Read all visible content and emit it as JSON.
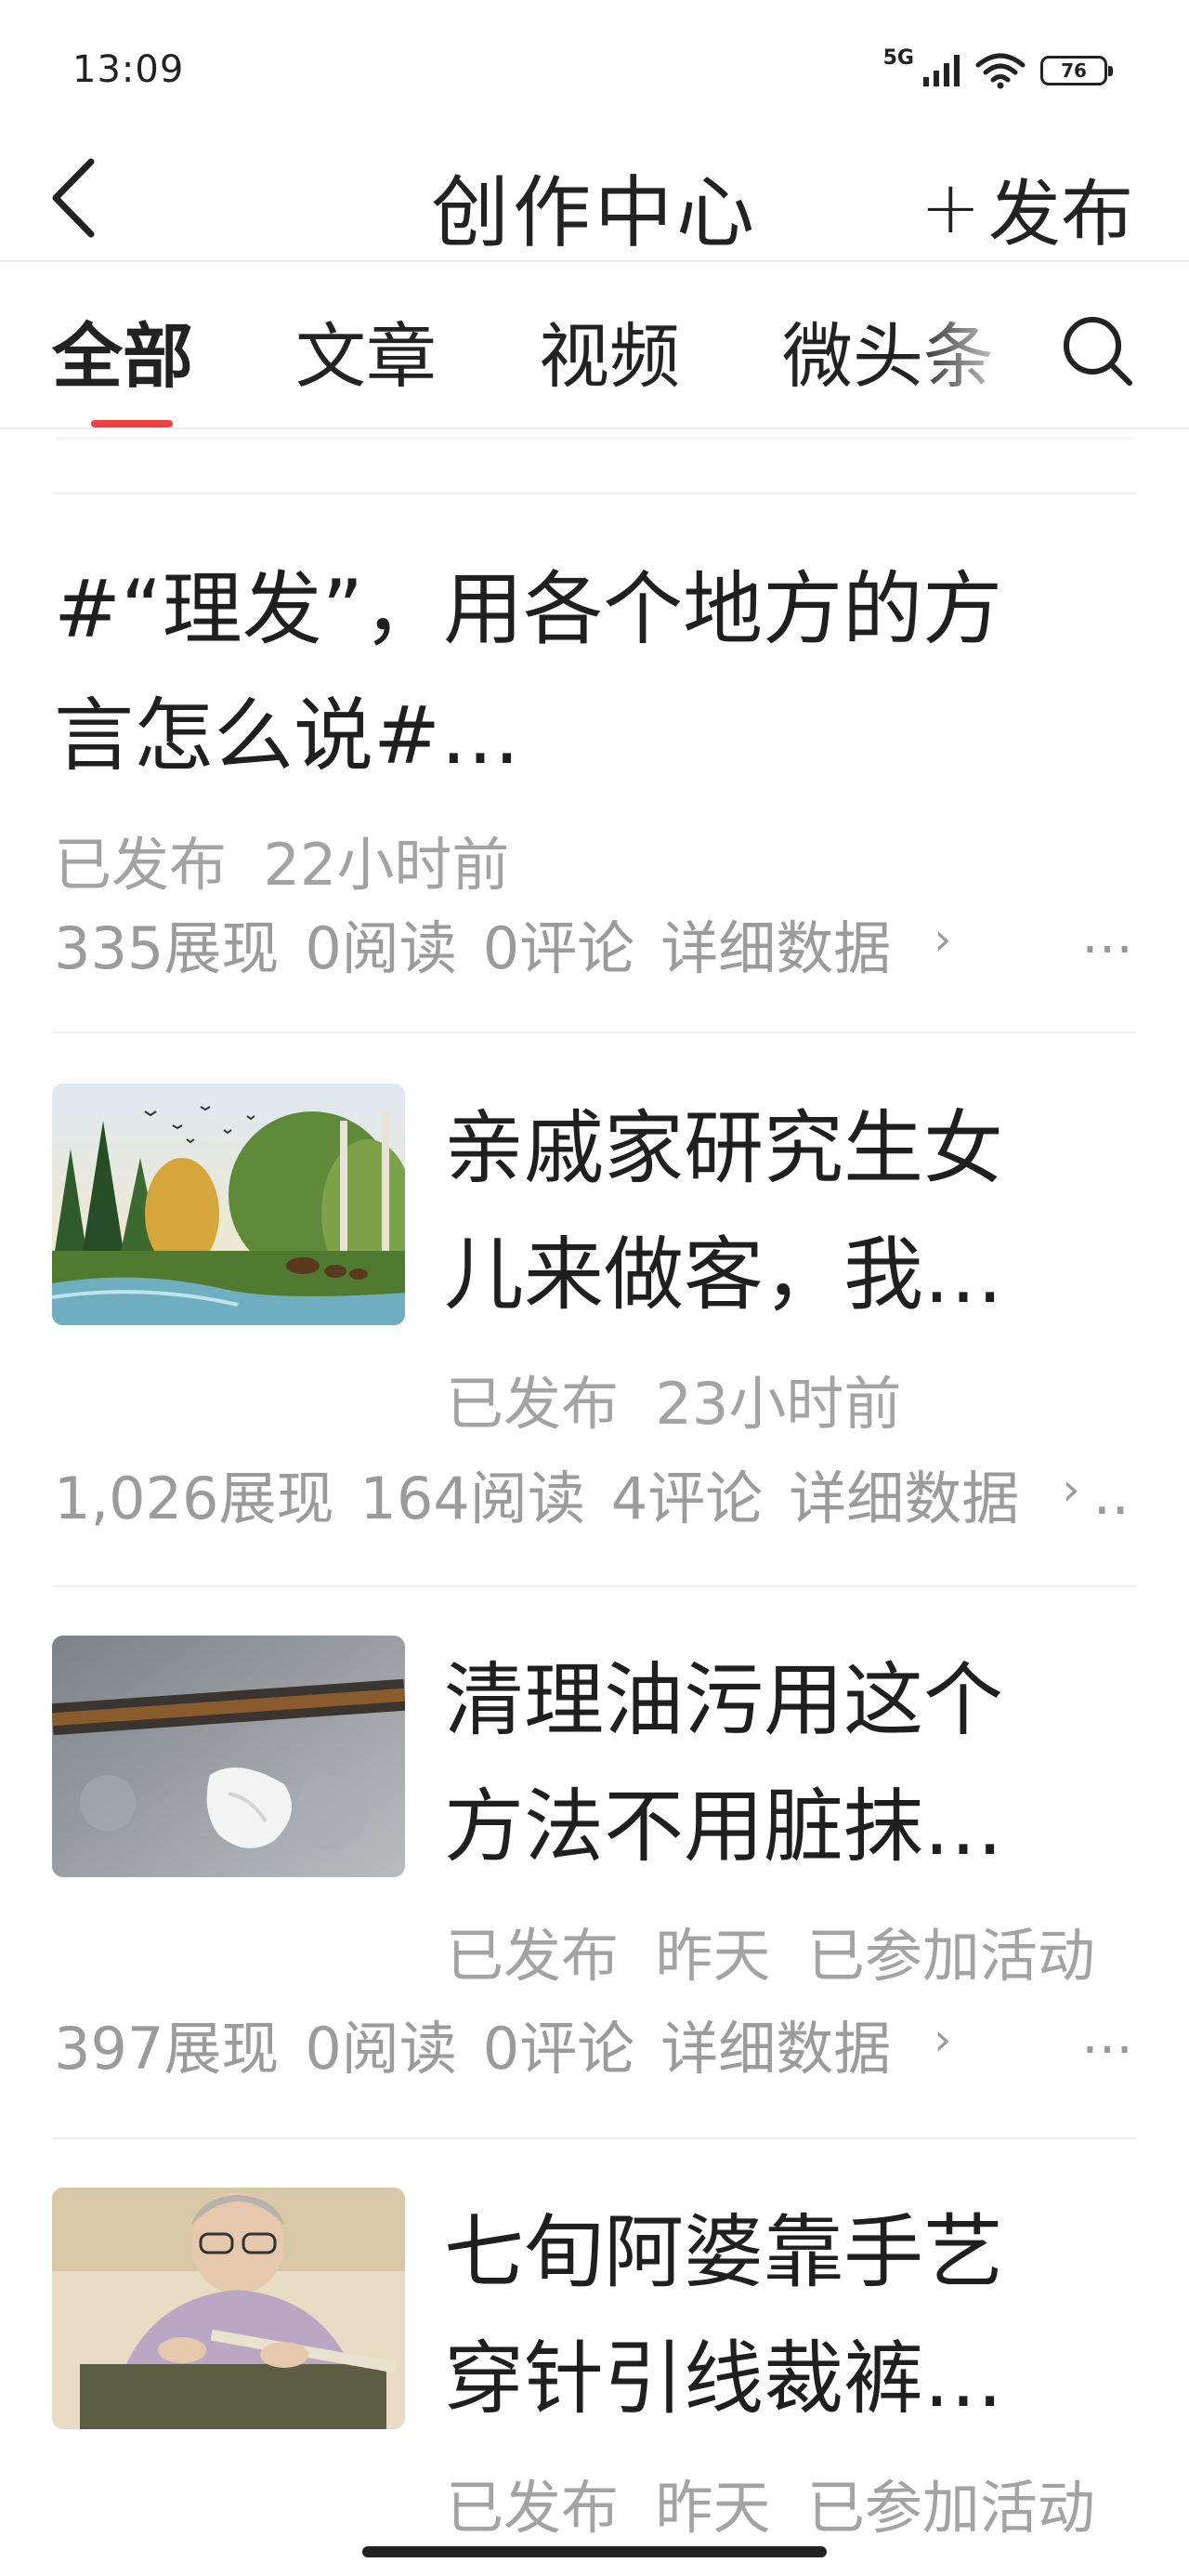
{
  "status_bar": {
    "time": "13:09",
    "network": "5G",
    "battery": "76"
  },
  "nav": {
    "title": "创作中心",
    "publish_plus": "+",
    "publish_label": "发布"
  },
  "tabs": [
    {
      "label": "全部",
      "active": true
    },
    {
      "label": "文章",
      "active": false
    },
    {
      "label": "视频",
      "active": false
    },
    {
      "label": "微头条",
      "active": false
    }
  ],
  "accent_color": "#f04142",
  "icons": {
    "back": "chevron-left-icon",
    "search": "search-icon",
    "more": "more-icon"
  },
  "feed": [
    {
      "title_line1": "#“理发”，用各个地方的方",
      "title_line2": "言怎么说#…",
      "status": "已发布",
      "time": "22小时前",
      "activity": "",
      "views": "335展现",
      "reads": "0阅读",
      "comments": "0评论",
      "detail": "详细数据",
      "more": "…"
    },
    {
      "title_line1": "亲戚家研究生女",
      "title_line2": "儿来做客，我…",
      "status": "已发布",
      "time": "23小时前",
      "activity": "",
      "views": "1,026展现",
      "reads": "164阅读",
      "comments": "4评论",
      "detail": "详细数据",
      "more": ".."
    },
    {
      "title_line1": "清理油污用这个",
      "title_line2": "方法不用脏抹…",
      "status": "已发布",
      "time": "昨天",
      "activity": "已参加活动",
      "views": "397展现",
      "reads": "0阅读",
      "comments": "0评论",
      "detail": "详细数据",
      "more": "…"
    },
    {
      "title_line1": "七旬阿婆靠手艺",
      "title_line2": "穿针引线裁裤…",
      "status": "已发布",
      "time": "昨天",
      "activity": "已参加活动"
    }
  ]
}
